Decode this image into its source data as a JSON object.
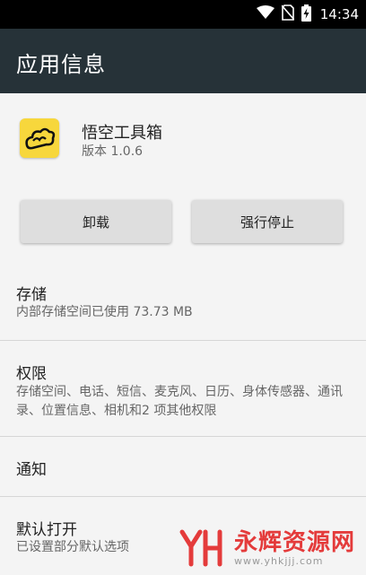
{
  "status_bar": {
    "time": "14:34",
    "icons": [
      "wifi-icon",
      "no-sim-icon",
      "battery-charging-icon"
    ]
  },
  "app_bar": {
    "title": "应用信息"
  },
  "app": {
    "name": "悟空工具箱",
    "version": "版本 1.0.6",
    "icon": "cloud-icon",
    "icon_color": "#f7d73c"
  },
  "buttons": {
    "uninstall": "卸载",
    "force_stop": "强行停止"
  },
  "storage": {
    "title": "存储",
    "detail": "内部存储空间已使用 73.73 MB"
  },
  "permissions": {
    "title": "权限",
    "detail": "存储空间、电话、短信、麦克风、日历、身体传感器、通讯录、位置信息、相机和2 项其他权限"
  },
  "notifications": {
    "title": "通知"
  },
  "default_open": {
    "title": "默认打开",
    "detail": "已设置部分默认选项"
  },
  "watermark": {
    "name": "永辉资源网",
    "url": "www.yhkjjj.com",
    "color": "#e43b3b"
  }
}
